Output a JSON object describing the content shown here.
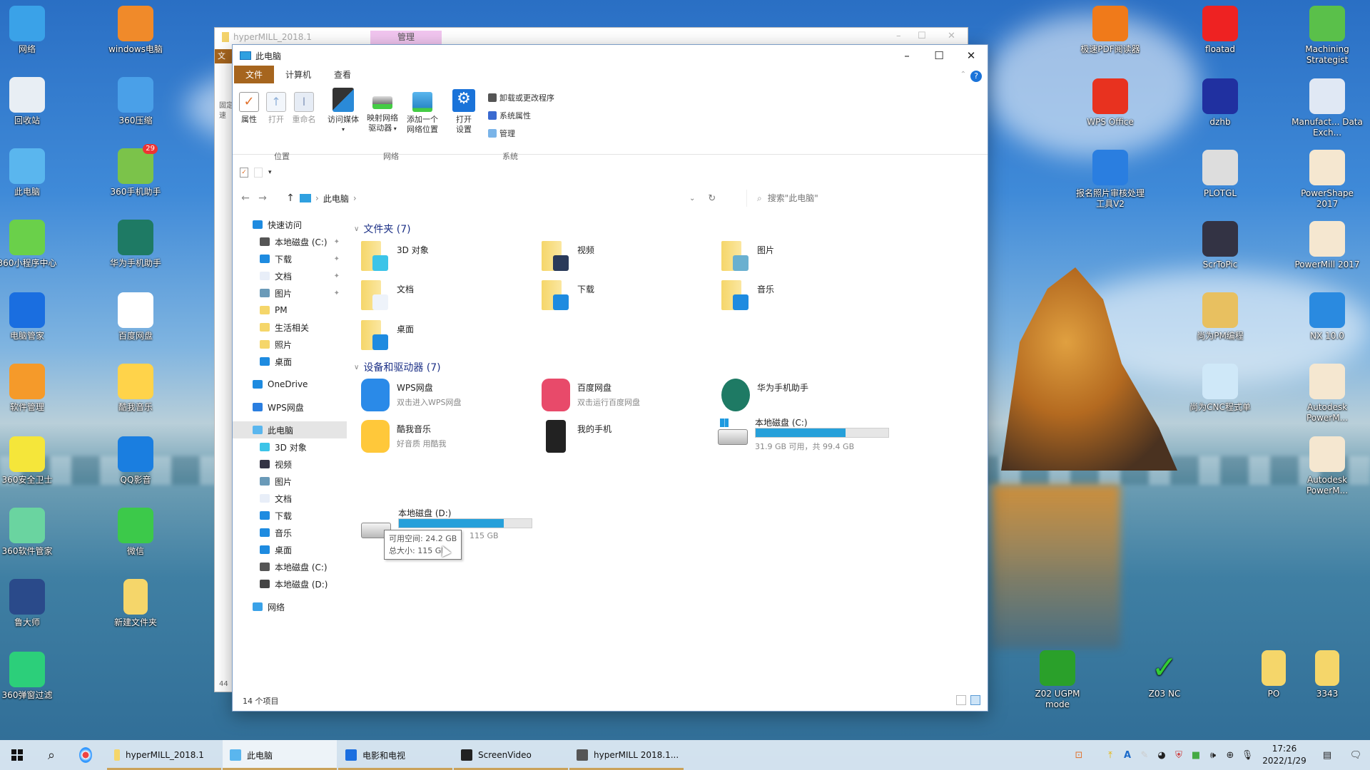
{
  "desktop": {
    "left_icons": [
      {
        "label": "网络",
        "icon": "network-icon"
      },
      {
        "label": "windows电脑",
        "icon": "windows-media-icon"
      },
      {
        "label": "回收站",
        "icon": "recycle-bin-icon"
      },
      {
        "label": "360压缩",
        "icon": "archive-icon"
      },
      {
        "label": "此电脑",
        "icon": "computer-icon"
      },
      {
        "label": "360手机助手",
        "icon": "phone-assistant-icon",
        "badge": "29"
      },
      {
        "label": "360小程序中心",
        "icon": "browser-icon"
      },
      {
        "label": "华为手机助手",
        "icon": "huawei-assistant-icon"
      },
      {
        "label": "电脑管家",
        "icon": "shield-icon"
      },
      {
        "label": "百度网盘",
        "icon": "baidu-cloud-icon"
      },
      {
        "label": "软件管理",
        "icon": "clover-icon"
      },
      {
        "label": "酷我音乐",
        "icon": "kuwo-music-icon"
      },
      {
        "label": "360安全卫士",
        "icon": "security-plus-icon"
      },
      {
        "label": "QQ影音",
        "icon": "film-reel-icon"
      },
      {
        "label": "360软件管家",
        "icon": "flower-icon"
      },
      {
        "label": "微信",
        "icon": "wechat-icon"
      },
      {
        "label": "鲁大师",
        "icon": "master-lu-icon"
      },
      {
        "label": "新建文件夹",
        "icon": "folder-icon"
      },
      {
        "label": "360弹窗过滤",
        "icon": "popup-filter-icon"
      }
    ],
    "right_icons": [
      {
        "label": "极速PDF阅读器",
        "icon": "pdf-icon"
      },
      {
        "label": "floatad",
        "icon": "no-ad-icon"
      },
      {
        "label": "Machining Strategist",
        "icon": "machining-icon"
      },
      {
        "label": "WPS Office",
        "icon": "wps-icon"
      },
      {
        "label": "dzhb",
        "icon": "pointer-hand-icon"
      },
      {
        "label": "Manufact... Data Exch...",
        "icon": "data-exchange-icon"
      },
      {
        "label": "报名照片审核处理工具V2",
        "icon": "photo-tool-icon"
      },
      {
        "label": "PLOTGL",
        "icon": "panda-icon"
      },
      {
        "label": "PowerShape 2017",
        "icon": "powershape-icon"
      },
      {
        "label": "ScrToPic",
        "icon": "crosshair-icon"
      },
      {
        "label": "PowerMill 2017",
        "icon": "powermill-icon"
      },
      {
        "label": "尚为PM编程",
        "icon": "y-logo-icon"
      },
      {
        "label": "NX 10.0",
        "icon": "nx-icon"
      },
      {
        "label": "尚为CNC程式单",
        "icon": "cnc-sheet-icon"
      },
      {
        "label": "Autodesk PowerM...",
        "icon": "powermill-icon"
      },
      {
        "label": "Autodesk PowerM...",
        "icon": "powermill-icon"
      },
      {
        "label": "Z02 UGPM mode",
        "icon": "tree-icon"
      },
      {
        "label": "Z03 NC",
        "icon": "checkmark-icon"
      },
      {
        "label": "PO",
        "icon": "folder-icon"
      },
      {
        "label": "3343",
        "icon": "folder-icon"
      }
    ]
  },
  "back_window": {
    "title": "hyperMILL_2018.1",
    "context_tab": "管理",
    "file_tab": "文",
    "edge_text_1": "固定",
    "edge_text_2": "速",
    "edge_count": "44"
  },
  "window": {
    "title": "此电脑",
    "menu_tabs": [
      {
        "label": "文件",
        "active": true
      },
      {
        "label": "计算机",
        "active": false
      },
      {
        "label": "查看",
        "active": false
      }
    ],
    "ribbon": {
      "location_group": "位置",
      "network_group": "网络",
      "system_group": "系统",
      "buttons": {
        "properties": "属性",
        "open": "打开",
        "rename": "重命名",
        "media": "访问媒体",
        "map_drive_1": "映射网络",
        "map_drive_2": "驱动器",
        "add_location_1": "添加一个",
        "add_location_2": "网络位置",
        "open_settings_1": "打开",
        "open_settings_2": "设置"
      },
      "system_items": [
        "卸载或更改程序",
        "系统属性",
        "管理"
      ]
    },
    "address": {
      "crumb": "此电脑",
      "search_placeholder": "搜索\"此电脑\""
    },
    "nav": {
      "quick_access": "快速访问",
      "quick_items": [
        {
          "label": "本地磁盘 (C:)",
          "pinned": true,
          "icon": "drive-c-icon"
        },
        {
          "label": "下载",
          "pinned": true,
          "icon": "download-icon"
        },
        {
          "label": "文档",
          "pinned": true,
          "icon": "document-icon"
        },
        {
          "label": "图片",
          "pinned": true,
          "icon": "picture-icon"
        },
        {
          "label": "PM",
          "pinned": false,
          "icon": "folder-icon"
        },
        {
          "label": "生活相关",
          "pinned": false,
          "icon": "folder-icon"
        },
        {
          "label": "照片",
          "pinned": false,
          "icon": "folder-icon"
        },
        {
          "label": "桌面",
          "pinned": false,
          "icon": "desktop-icon"
        }
      ],
      "onedrive": "OneDrive",
      "wps": "WPS网盘",
      "this_pc": "此电脑",
      "pc_items": [
        {
          "label": "3D 对象",
          "icon": "3d-objects-icon"
        },
        {
          "label": "视频",
          "icon": "video-icon"
        },
        {
          "label": "图片",
          "icon": "picture-icon"
        },
        {
          "label": "文档",
          "icon": "document-icon"
        },
        {
          "label": "下载",
          "icon": "download-icon"
        },
        {
          "label": "音乐",
          "icon": "music-icon"
        },
        {
          "label": "桌面",
          "icon": "desktop-icon"
        },
        {
          "label": "本地磁盘 (C:)",
          "icon": "drive-c-icon"
        },
        {
          "label": "本地磁盘 (D:)",
          "icon": "drive-d-icon"
        }
      ],
      "network": "网络"
    },
    "folders_header": "文件夹 (7)",
    "folders": [
      {
        "label": "3D 对象",
        "icon": "3d-objects-icon"
      },
      {
        "label": "视频",
        "icon": "video-icon"
      },
      {
        "label": "图片",
        "icon": "picture-icon"
      },
      {
        "label": "文档",
        "icon": "document-icon"
      },
      {
        "label": "下载",
        "icon": "download-icon"
      },
      {
        "label": "音乐",
        "icon": "music-icon"
      },
      {
        "label": "桌面",
        "icon": "desktop-icon"
      }
    ],
    "devices_header": "设备和驱动器 (7)",
    "devices": [
      {
        "label": "WPS网盘",
        "sub": "双击进入WPS网盘",
        "icon": "wps-cloud-icon"
      },
      {
        "label": "百度网盘",
        "sub": "双击运行百度网盘",
        "icon": "baidu-cloud-icon"
      },
      {
        "label": "华为手机助手",
        "sub": "",
        "icon": "huawei-assistant-icon"
      },
      {
        "label": "酷我音乐",
        "sub": "好音质 用酷我",
        "icon": "kuwo-music-icon"
      },
      {
        "label": "我的手机",
        "sub": "",
        "icon": "phone-icon"
      }
    ],
    "drives": [
      {
        "label": "本地磁盘 (C:)",
        "info": "31.9 GB 可用，共 99.4 GB",
        "used_fraction": 0.68
      },
      {
        "label": "本地磁盘 (D:)",
        "info": "24.2 GB 可用，共 115 GB",
        "visible_info": "115 GB",
        "used_fraction": 0.79
      }
    ],
    "tooltip": {
      "line1": "可用空间: 24.2 GB",
      "line2": "总大小: 115 GB"
    },
    "status": "14 个项目"
  },
  "taskbar": {
    "apps": [
      {
        "label": "hyperMILL_2018.1",
        "active": false,
        "icon": "folder-icon"
      },
      {
        "label": "此电脑",
        "active": true,
        "icon": "computer-icon"
      },
      {
        "label": "电影和电视",
        "active": false,
        "icon": "movies-tv-icon"
      },
      {
        "label": "ScreenVideo",
        "active": false,
        "icon": "screen-video-icon"
      },
      {
        "label": "hyperMILL 2018.1...",
        "active": false,
        "icon": "hypermill-icon"
      }
    ],
    "time": "17:26",
    "date": "2022/1/29"
  },
  "colors": {
    "file_tab": "#a6651e",
    "manage_tab": "#f2c6f0",
    "drive_bar": "#26a0da",
    "group_header": "#1e3287"
  }
}
